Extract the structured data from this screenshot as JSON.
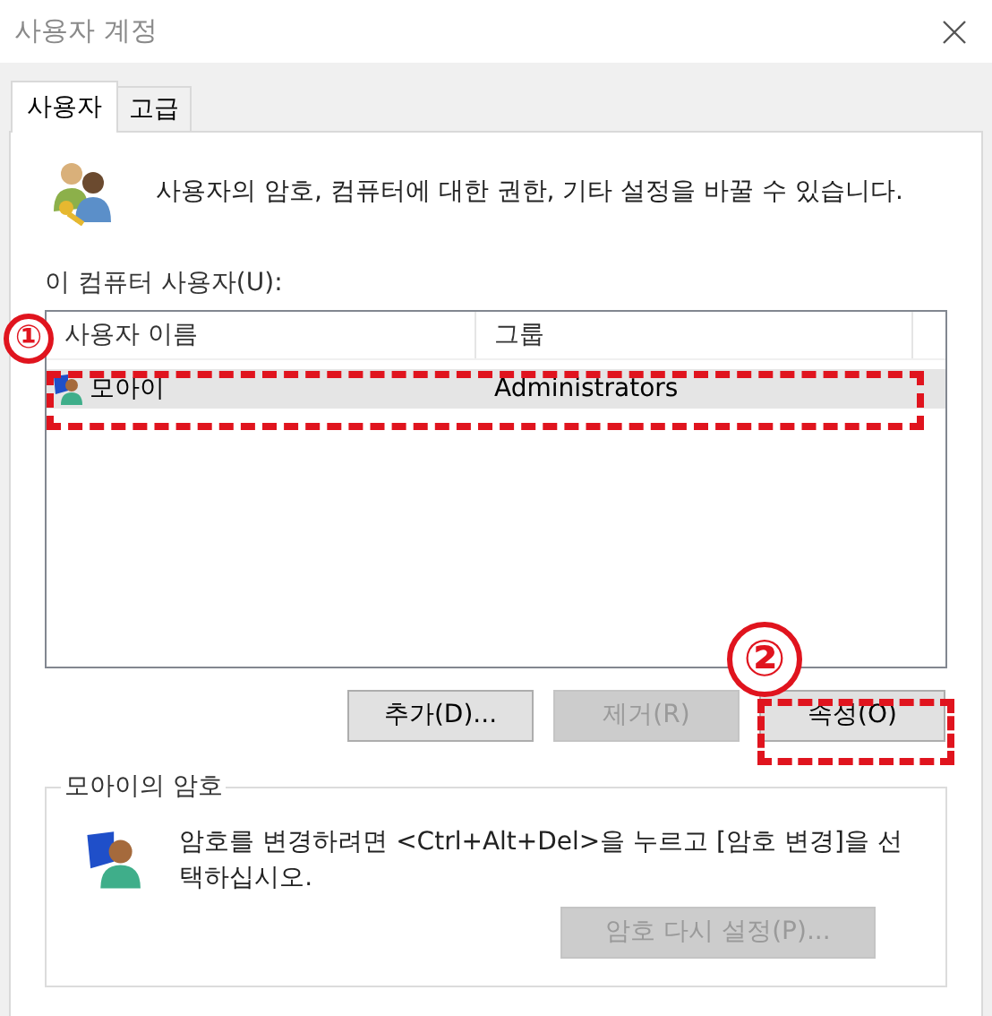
{
  "window": {
    "title": "사용자 계정"
  },
  "tabs": [
    {
      "label": "사용자",
      "selected": true
    },
    {
      "label": "고급",
      "selected": false
    }
  ],
  "intro": "사용자의 암호, 컴퓨터에 대한 권한, 기타 설정을 바꿀 수 있습니다.",
  "users_label": "이 컴퓨터 사용자(U):",
  "table": {
    "columns": [
      "사용자 이름",
      "그룹"
    ],
    "rows": [
      {
        "cells": [
          "모아이",
          "Administrators"
        ],
        "selected": true
      }
    ]
  },
  "buttons": [
    {
      "label": "추가(D)...",
      "disabled": false
    },
    {
      "label": "제거(R)",
      "disabled": true
    },
    {
      "label": "속성(O)",
      "disabled": false
    }
  ],
  "password_group": {
    "title": "모아이의 암호",
    "message": "암호를 변경하려면 <Ctrl+Alt+Del>을 누르고 [암호 변경]을 선택하십시오.",
    "button": {
      "label": "암호 다시 설정(P)...",
      "disabled": true
    }
  },
  "annotations": [
    {
      "label": "①"
    },
    {
      "label": "②"
    }
  ]
}
